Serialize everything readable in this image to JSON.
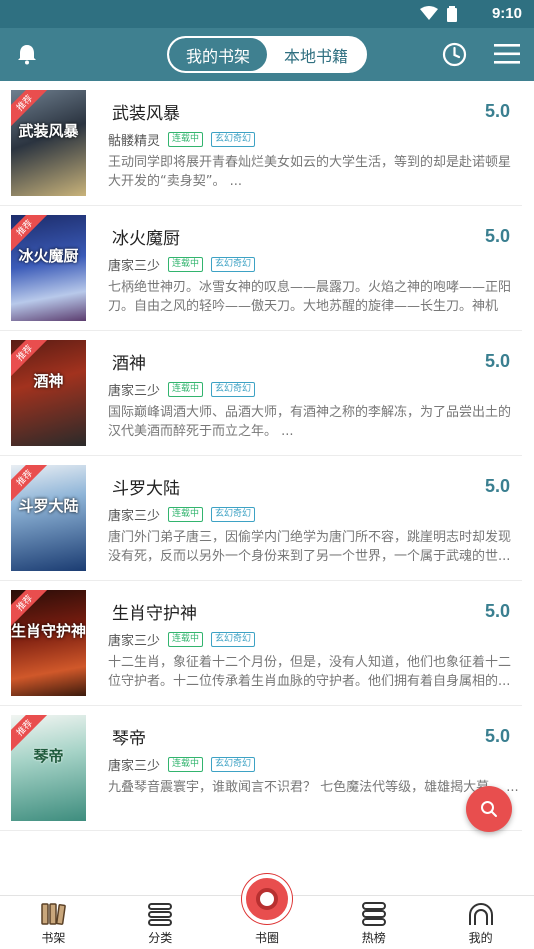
{
  "statusbar": {
    "time": "9:10"
  },
  "header": {
    "tabs": [
      {
        "label": "我的书架",
        "active": true
      },
      {
        "label": "本地书籍",
        "active": false
      }
    ]
  },
  "books": [
    {
      "title": "武装风暴",
      "cover_title": "武装风暴",
      "tag": "推荐",
      "rating": "5.0",
      "author": "骷髅精灵",
      "status": "连载中",
      "genre": "玄幻奇幻",
      "desc": "王动同学即将展开青春灿烂美女如云的大学生活，等到的却是赴诺顿星大开发的“卖身契”。 ..."
    },
    {
      "title": "冰火魔厨",
      "cover_title": "冰火魔厨",
      "tag": "推荐",
      "rating": "5.0",
      "author": "唐家三少",
      "status": "连载中",
      "genre": "玄幻奇幻",
      "desc": "七柄绝世神刃。冰雪女神的叹息——晨露刀。火焰之神的咆哮——正阳刀。自由之风的轻吟——傲天刀。大地苏醒的旋律——长生刀。神机百..."
    },
    {
      "title": "酒神",
      "cover_title": "酒神",
      "tag": "推荐",
      "rating": "5.0",
      "author": "唐家三少",
      "status": "连载中",
      "genre": "玄幻奇幻",
      "desc": "国际巅峰调酒大师、品酒大师，有酒神之称的李解冻，为了品尝出土的汉代美酒而醉死于而立之年。 ..."
    },
    {
      "title": "斗罗大陆",
      "cover_title": "斗罗大陆",
      "tag": "推荐",
      "rating": "5.0",
      "author": "唐家三少",
      "status": "连载中",
      "genre": "玄幻奇幻",
      "desc": "唐门外门弟子唐三，因偷学内门绝学为唐门所不容，跳崖明志时却发现没有死，反而以另外一个身份来到了另一个世界，一个属于武魂的世..."
    },
    {
      "title": "生肖守护神",
      "cover_title": "生肖守护神",
      "tag": "推荐",
      "rating": "5.0",
      "author": "唐家三少",
      "status": "连载中",
      "genre": "玄幻奇幻",
      "desc": "十二生肖，象征着十二个月份，但是，没有人知道，他们也象征着十二位守护者。十二位传承着生肖血脉的守护者。他们拥有着自身属相的..."
    },
    {
      "title": "琴帝",
      "cover_title": "琴帝",
      "tag": "推荐",
      "rating": "5.0",
      "author": "唐家三少",
      "status": "连载中",
      "genre": "玄幻奇幻",
      "desc": "九叠琴音震寰宇，谁敢闻言不识君？ 七色魔法代等级，雄雄揭大幕。 ..."
    }
  ],
  "tabbar": [
    {
      "label": "书架",
      "icon": "bookshelf-icon"
    },
    {
      "label": "分类",
      "icon": "category-icon"
    },
    {
      "label": "书圈",
      "icon": "circle-icon"
    },
    {
      "label": "热榜",
      "icon": "ranking-icon"
    },
    {
      "label": "我的",
      "icon": "profile-icon"
    }
  ],
  "colors": {
    "header": "#3f8090",
    "accent": "#e84e4e",
    "rating": "#3a7f90"
  }
}
